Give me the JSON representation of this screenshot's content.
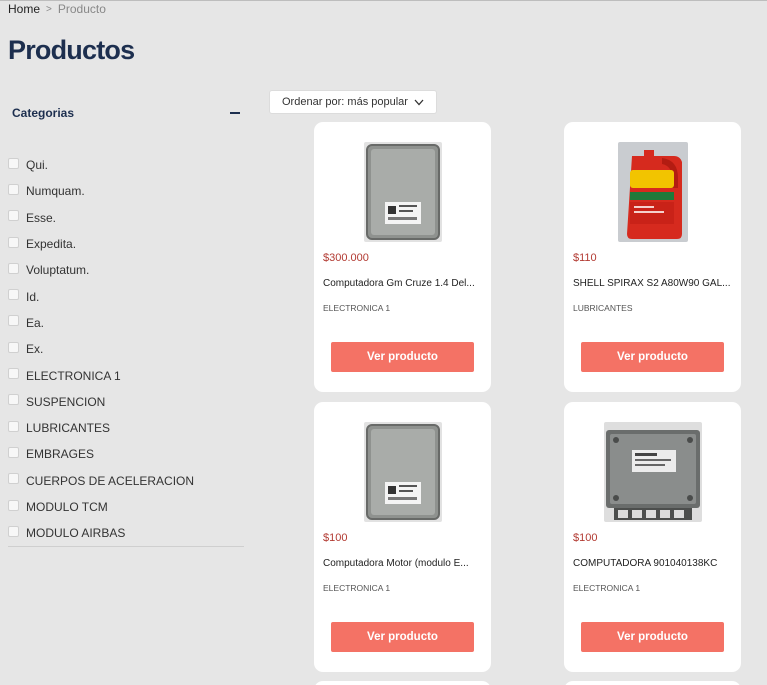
{
  "breadcrumb": {
    "home": "Home",
    "separator": ">",
    "current": "Producto"
  },
  "page_title": "Productos",
  "sidebar": {
    "title": "Categorias",
    "categories": [
      "Qui.",
      "Numquam.",
      "Esse.",
      "Expedita.",
      "Voluptatum.",
      "Id.",
      "Ea.",
      "Ex.",
      "ELECTRONICA 1",
      "SUSPENCION",
      "LUBRICANTES",
      "EMBRAGES",
      "CUERPOS DE ACELERACION",
      "MODULO TCM",
      "MODULO AIRBAS"
    ]
  },
  "sort": {
    "label": "Ordenar por: más popular"
  },
  "products": [
    {
      "price": "$300.000",
      "name": "Computadora Gm Cruze 1.4 Del...",
      "category": "ELECTRONICA 1",
      "button": "Ver producto",
      "image": "ecu-module"
    },
    {
      "price": "$110",
      "name": "SHELL SPIRAX S2 A80W90 GAL...",
      "category": "LUBRICANTES",
      "button": "Ver producto",
      "image": "oil-bottle"
    },
    {
      "price": "$100",
      "name": "Computadora Motor (modulo E...",
      "category": "ELECTRONICA 1",
      "button": "Ver producto",
      "image": "ecu-module"
    },
    {
      "price": "$100",
      "name": "COMPUTADORA 901040138KC",
      "category": "ELECTRONICA 1",
      "button": "Ver producto",
      "image": "ecu-unit"
    }
  ],
  "colors": {
    "accent": "#f47265",
    "price": "#b23a32",
    "title": "#1d2f4f",
    "background": "#e6e6e6"
  }
}
